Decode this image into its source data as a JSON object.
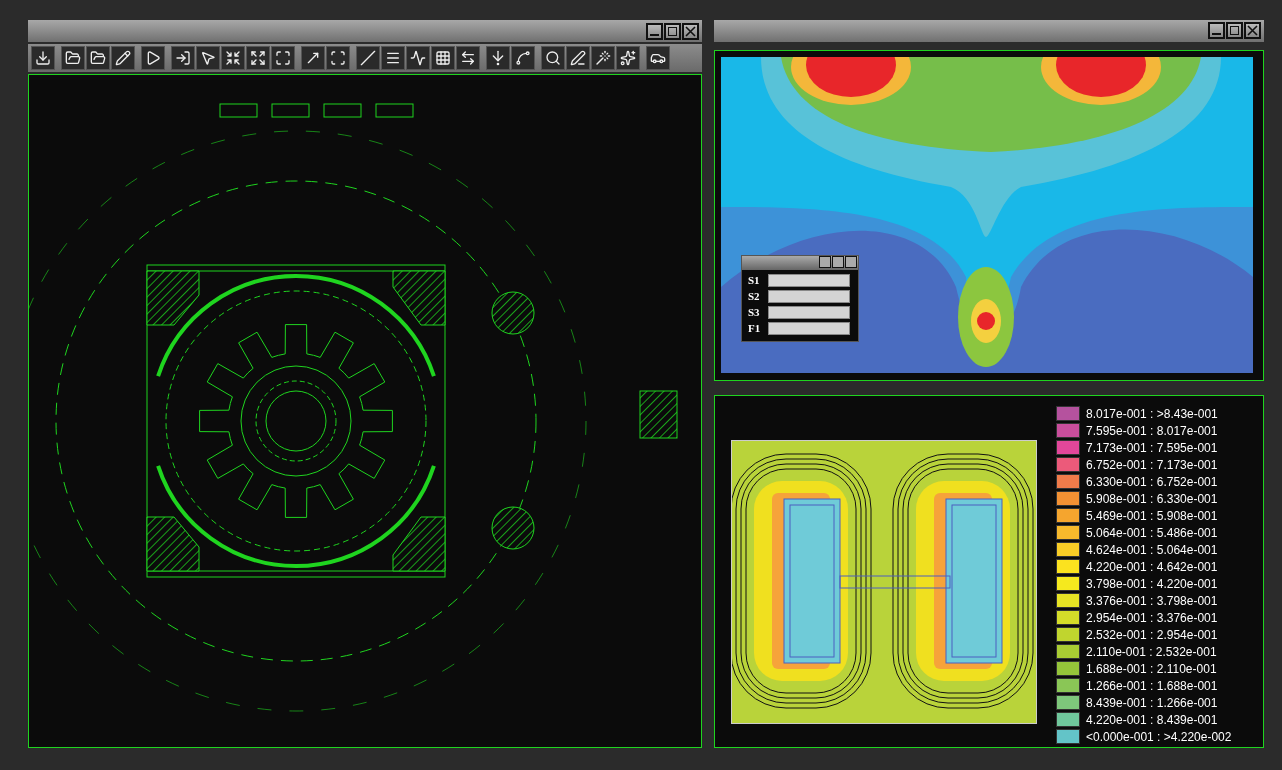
{
  "dialog": {
    "fields": [
      {
        "label": "S1"
      },
      {
        "label": "S2"
      },
      {
        "label": "S3"
      },
      {
        "label": "F1"
      }
    ]
  },
  "legend": {
    "items": [
      {
        "label": "8.017e-001 : >8.43e-001",
        "color": "#b5529e"
      },
      {
        "label": "7.595e-001 : 8.017e-001",
        "color": "#c94e9c"
      },
      {
        "label": "7.173e-001 : 7.595e-001",
        "color": "#e2479a"
      },
      {
        "label": "6.752e-001 : 7.173e-001",
        "color": "#ec5a7a"
      },
      {
        "label": "6.330e-001 : 6.752e-001",
        "color": "#f07b4a"
      },
      {
        "label": "5.908e-001 : 6.330e-001",
        "color": "#f39133"
      },
      {
        "label": "5.469e-001 : 5.908e-001",
        "color": "#f5a52e"
      },
      {
        "label": "5.064e-001 : 5.486e-001",
        "color": "#f7b92c"
      },
      {
        "label": "4.624e-001 : 5.064e-001",
        "color": "#f9cd26"
      },
      {
        "label": "4.220e-001 : 4.642e-001",
        "color": "#fbe21f"
      },
      {
        "label": "3.798e-001 : 4.220e-001",
        "color": "#f5e91e"
      },
      {
        "label": "3.376e-001 : 3.798e-001",
        "color": "#e6e324"
      },
      {
        "label": "2.954e-001 : 3.376e-001",
        "color": "#d4dc29"
      },
      {
        "label": "2.532e-001 : 2.954e-001",
        "color": "#c0d52e"
      },
      {
        "label": "2.110e-001 : 2.532e-001",
        "color": "#a9cc33"
      },
      {
        "label": "1.688e-001 : 2.110e-001",
        "color": "#95c43a"
      },
      {
        "label": "1.266e-001 : 1.688e-001",
        "color": "#8ac656"
      },
      {
        "label": "8.439e-001 : 1.266e-001",
        "color": "#7ec77b"
      },
      {
        "label": "4.220e-001 : 8.439e-001",
        "color": "#70c79c"
      },
      {
        "label": "<0.000e-001 : >4.220e-002",
        "color": "#63c4c8"
      }
    ]
  }
}
